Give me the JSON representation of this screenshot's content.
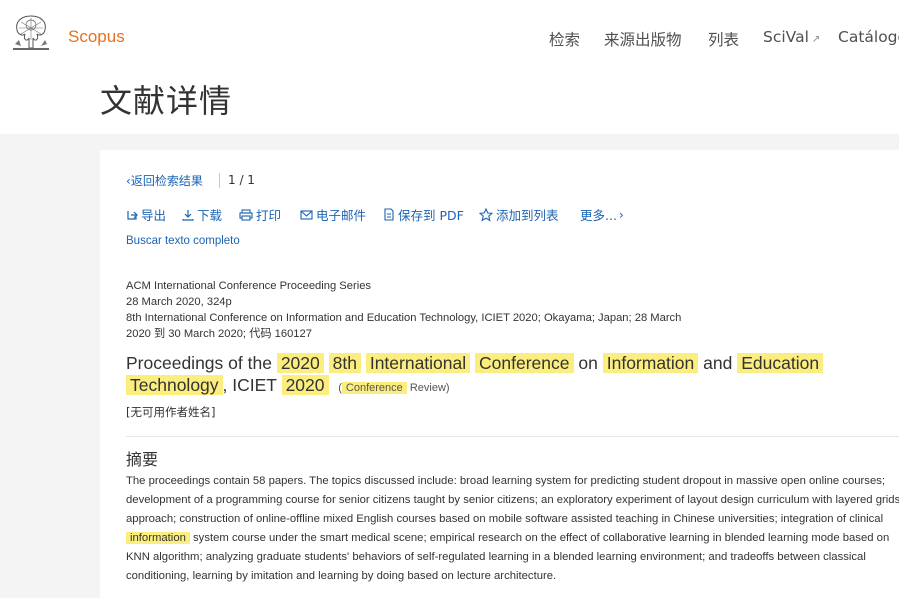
{
  "header": {
    "brand": "Scopus",
    "nav": [
      "检索",
      "来源出版物",
      "列表",
      "SciVal",
      "Catálogo"
    ]
  },
  "page_title": "文献详情",
  "result_nav": {
    "back_label": "返回检索结果",
    "pager": "1 / 1"
  },
  "actions": {
    "export": "导出",
    "download": "下载",
    "print": "打印",
    "email": "电子邮件",
    "save_pdf": "保存到 PDF",
    "add_to_list": "添加到列表",
    "more": "更多..."
  },
  "fulltext_link": "Buscar texto completo",
  "source": {
    "series": "ACM International Conference Proceeding Series",
    "date_pages": "28 March 2020, 324p",
    "conference_line1": "8th International Conference on Information and Education Technology, ICIET 2020; Okayama; Japan; 28 March",
    "conference_line2": "2020 到 30 March 2020; 代码 160127"
  },
  "title": {
    "w1": "Proceedings of the",
    "w2": "2020",
    "w3": "8th",
    "w4": "International",
    "w5": "Conference",
    "w6": "on",
    "w7": "Information",
    "w8": "and",
    "w9": "Education",
    "w10": "Technology",
    "w11": ", ICIET",
    "w12": "2020",
    "type_open": "(",
    "type_hl": "Conference",
    "type_rest": "Review)"
  },
  "authors": "[无可用作者姓名]",
  "abstract": {
    "heading": "摘要",
    "part1": "The proceedings contain 58 papers. The topics discussed include: broad learning system for predicting student dropout in massive open online courses; development of a programming course for senior citizens taught by senior citizens; an exploratory experiment of layout design curriculum with layered grids approach; construction of online-offline mixed English courses based on mobile software assisted teaching in Chinese universities; integration of clinical",
    "highlight": "information",
    "part2": "system course under the smart medical scene; empirical research on the effect of collaborative learning in blended learning mode based on KNN algorithm; analyzing graduate students' behaviors of self-regulated learning in a blended learning environment; and tradeoffs between classical conditioning, learning by imitation and learning by doing based on lecture architecture."
  },
  "colors": {
    "brand": "#e9711c",
    "link": "#1b63b5",
    "highlight": "#fcee7e"
  }
}
